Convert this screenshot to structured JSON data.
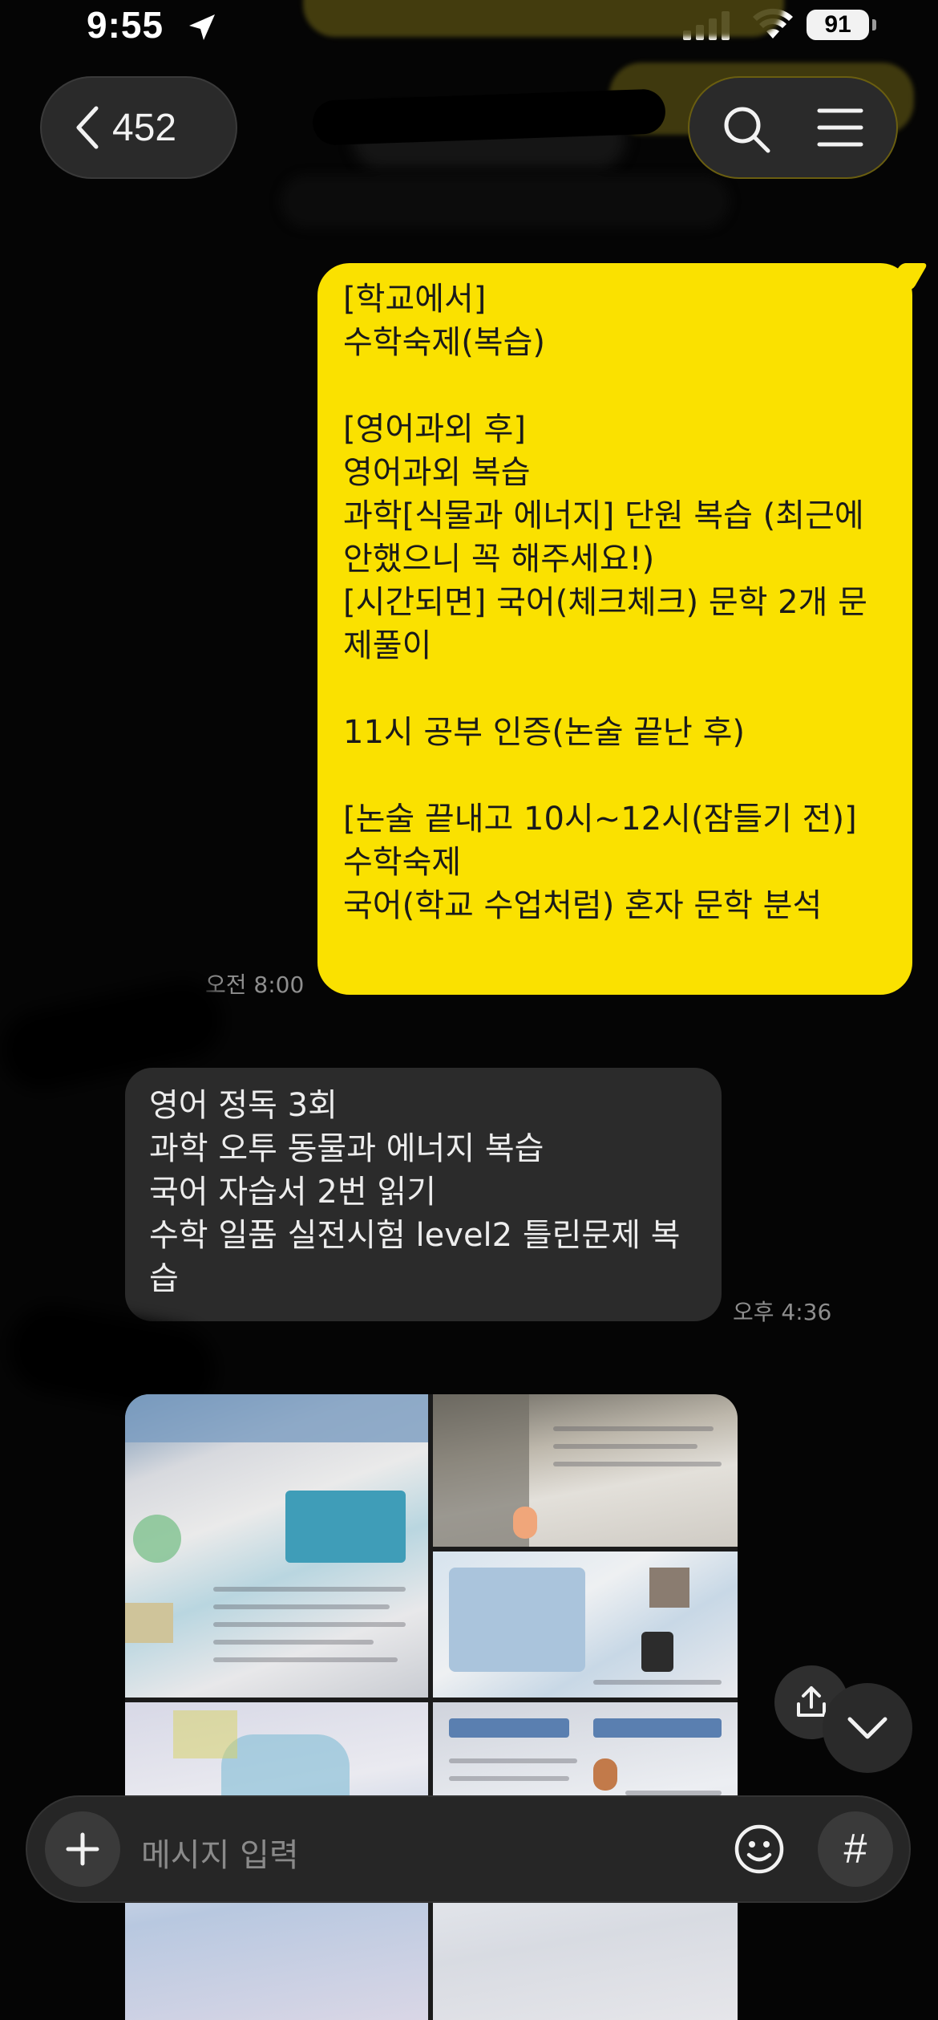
{
  "status_bar": {
    "time": "9:55",
    "battery": "91"
  },
  "header": {
    "back_count": "452"
  },
  "messages": [
    {
      "direction": "sent",
      "text": "[학교에서]\n수학숙제(복습)\n\n[영어과외 후]\n영어과외 복습\n과학[식물과 에너지] 단원 복습 (최근에 안했으니 꼭 해주세요!)\n[시간되면] 국어(체크체크) 문학 2개 문제풀이\n\n11시 공부 인증(논술 끝난 후)\n\n[논술 끝내고 10시~12시(잠들기 전)]\n수학숙제\n국어(학교 수업처럼) 혼자 문학 분석",
      "time": "오전 8:00"
    },
    {
      "direction": "received",
      "text": "영어 정독 3회\n과학 오투 동물과 에너지 복습\n국어 자습서 2번 읽기\n수학 일품 실전시험 level2 틀린문제 복습",
      "time": "오후 4:36"
    }
  ],
  "input": {
    "placeholder": "메시지 입력"
  },
  "icons": {
    "back": "chevron-left-icon",
    "search": "search-icon",
    "menu": "hamburger-menu-icon",
    "share": "share-icon",
    "scroll_down": "chevron-down-icon",
    "attach": "plus-icon",
    "emoji": "emoji-icon",
    "hashtag": "hashtag-icon"
  },
  "colors": {
    "sent_bubble": "#fae100",
    "received_bubble": "#2b2b2b",
    "background": "#050505"
  }
}
